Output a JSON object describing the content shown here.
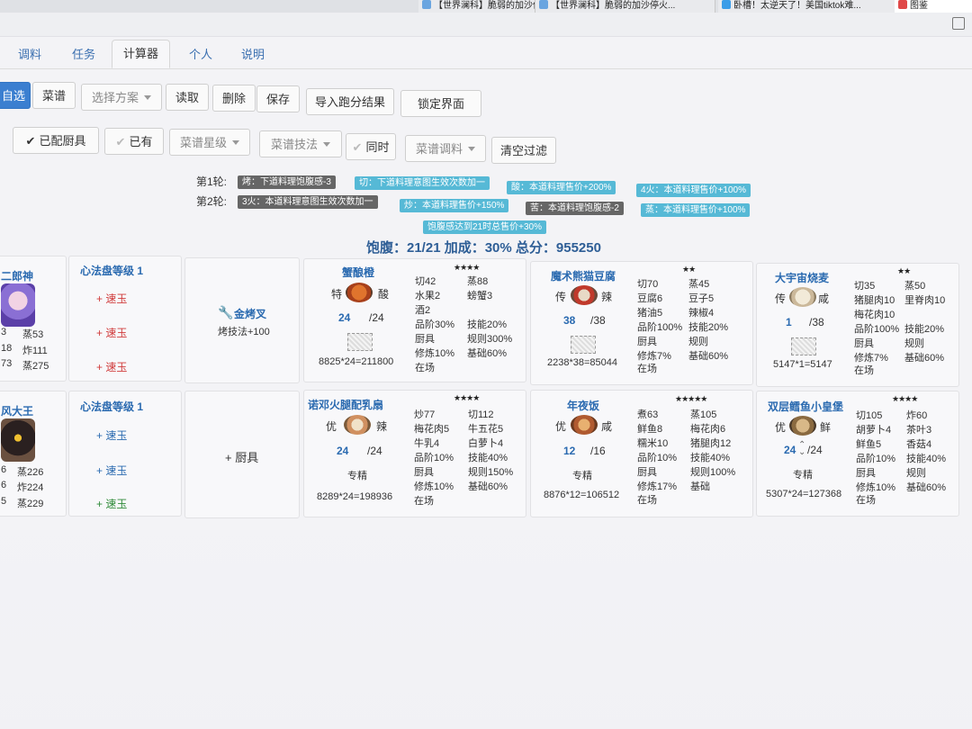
{
  "browser": {
    "tabs": [
      "【世界澜科】脆弱的加沙停火...",
      "卧槽！太逆天了！美国tiktok难...",
      "图鉴"
    ]
  },
  "app_tabs": [
    "调料",
    "任务",
    "计算器",
    "个人",
    "说明"
  ],
  "toolbar1": {
    "selected": "自选",
    "recipe": "菜谱",
    "scheme_select": "选择方案",
    "read": "读取",
    "delete": "删除",
    "save": "保存",
    "import": "导入跑分结果",
    "lock": "锁定界面"
  },
  "toolbar2": {
    "assigned_chef": "已配厨具",
    "owned": "已有",
    "recipe_grade": "菜谱星级",
    "recipe_skill": "菜谱技法",
    "simultaneous": "同时",
    "recipe_seasoning": "菜谱调料",
    "clear_filter": "清空过滤"
  },
  "rounds": {
    "r1_label": "第1轮:",
    "r1_badges": [
      "烤：下道料理饱腹感-3",
      "切：下道料理意图生效次数加一",
      "酸：本道料理售价+200%",
      "4火：本道料理售价+100%"
    ],
    "r2_label": "第2轮:",
    "r2_badges": [
      "3火：本道料理意图生效次数加一",
      "炒：本道料理售价+150%",
      "苦：本道料理饱腹感-2",
      "蒸：本道料理售价+100%"
    ],
    "r3_badge": "饱腹感达到21时总售价+30%"
  },
  "summary": "饱腹：21/21 加成：30% 总分：955250",
  "chefs": [
    {
      "name": "二郎神",
      "stats": [
        "3",
        "蒸53",
        "18",
        "炸111",
        "73",
        "蒸275"
      ],
      "level_label": "心法盘等级 1",
      "jades": [
        "+ 速玉",
        "+ 速玉",
        "+ 速玉"
      ],
      "equip_name": "金烤叉",
      "equip_effect": "烤技法+100",
      "dishes": [
        {
          "name": "蟹酿橙",
          "stars": "★★★★",
          "tag1": "特",
          "tag2": "酸",
          "count": "24",
          "denom": "/24",
          "equation": "8825*24=211800",
          "left": [
            "切42",
            "水果2",
            "酒2",
            "品阶30%",
            "厨具",
            "修炼10%",
            "在场"
          ],
          "right": [
            "蒸88",
            "螃蟹3",
            "",
            "技能20%",
            "规则300%",
            "基础60%"
          ]
        },
        {
          "name": "魔术熊猫豆腐",
          "stars": "★★",
          "tag1": "传",
          "tag2": "辣",
          "count": "38",
          "denom": "/38",
          "equation": "2238*38=85044",
          "left": [
            "切70",
            "豆腐6",
            "猪油5",
            "品阶100%",
            "厨具",
            "修炼7%",
            "在场"
          ],
          "right": [
            "蒸45",
            "豆子5",
            "辣椒4",
            "技能20%",
            "规则",
            "基础60%"
          ]
        },
        {
          "name": "大宇宙烧麦",
          "stars": "★★",
          "tag1": "传",
          "tag2": "咸",
          "count": "1",
          "denom": "/38",
          "equation": "5147*1=5147",
          "left": [
            "切35",
            "猪腿肉10",
            "梅花肉10",
            "品阶100%",
            "厨具",
            "修炼7%",
            "在场"
          ],
          "right": [
            "蒸50",
            "里脊肉10",
            "",
            "技能20%",
            "规则",
            "基础60%"
          ]
        }
      ]
    },
    {
      "name": "风大王",
      "stats": [
        "6",
        "蒸226",
        "6",
        "炸224",
        "5",
        "蒸229"
      ],
      "level_label": "心法盘等级 1",
      "jades": [
        "+ 速玉",
        "+ 速玉",
        "+ 速玉"
      ],
      "equip_name": "+ 厨具",
      "dishes": [
        {
          "name": "诺邓火腿配乳扇",
          "stars": "★★★★",
          "tag1": "优",
          "tag2": "辣",
          "count": "24",
          "denom": "/24",
          "specialty": "专精",
          "equation": "8289*24=198936",
          "left": [
            "炒77",
            "梅花肉5",
            "牛乳4",
            "品阶10%",
            "厨具",
            "修炼10%",
            "在场"
          ],
          "right": [
            "切112",
            "牛五花5",
            "白萝卜4",
            "技能40%",
            "规则150%",
            "基础60%"
          ]
        },
        {
          "name": "年夜饭",
          "stars": "★★★★★",
          "tag1": "优",
          "tag2": "咸",
          "count": "12",
          "denom": "/16",
          "specialty": "专精",
          "equation": "8876*12=106512",
          "left": [
            "煮63",
            "鲜鱼8",
            "糯米10",
            "品阶10%",
            "厨具",
            "修炼17%",
            "在场"
          ],
          "right": [
            "蒸105",
            "梅花肉6",
            "猪腿肉12",
            "技能40%",
            "规则100%",
            "基础"
          ]
        },
        {
          "name": "双层鳕鱼小皇堡",
          "stars": "★★★★",
          "tag1": "优",
          "tag2": "鲜",
          "count": "24",
          "denom": "/24",
          "specialty": "专精",
          "equation": "5307*24=127368",
          "left": [
            "切105",
            "胡萝卜4",
            "鲜鱼5",
            "品阶10%",
            "厨具",
            "修炼10%",
            "在场"
          ],
          "right": [
            "炸60",
            "茶叶3",
            "香菇4",
            "技能40%",
            "规则",
            "基础60%"
          ]
        }
      ]
    }
  ],
  "colors": {
    "primary": "#3b7fd0",
    "badge_dark": "#666666",
    "badge_blue": "#56b9d6",
    "title_blue": "#2a6ab0",
    "jade_red": "#d03b3b",
    "jade_blue": "#2a6ab0",
    "jade_green": "#2e8a38"
  }
}
